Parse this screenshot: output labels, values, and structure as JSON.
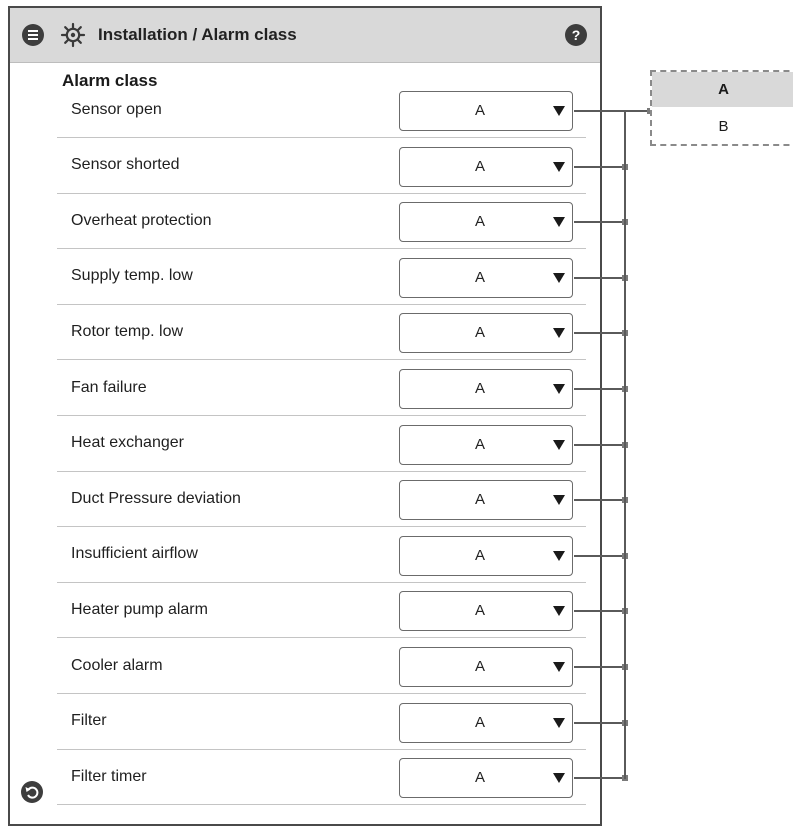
{
  "header": {
    "title": "Installation / Alarm class",
    "menu_icon": "menu-icon",
    "settings_icon": "gear-icon",
    "help_label": "?"
  },
  "section_title": "Alarm class",
  "rows": [
    {
      "label": "Sensor open",
      "value": "A"
    },
    {
      "label": "Sensor shorted",
      "value": "A"
    },
    {
      "label": "Overheat protection",
      "value": "A"
    },
    {
      "label": "Supply temp. low",
      "value": "A"
    },
    {
      "label": "Rotor temp. low",
      "value": "A"
    },
    {
      "label": "Fan failure",
      "value": "A"
    },
    {
      "label": "Heat exchanger",
      "value": "A"
    },
    {
      "label": "Duct Pressure deviation",
      "value": "A"
    },
    {
      "label": "Insufficient airflow",
      "value": "A"
    },
    {
      "label": "Heater pump alarm",
      "value": "A"
    },
    {
      "label": "Cooler alarm",
      "value": "A"
    },
    {
      "label": "Filter",
      "value": "A"
    },
    {
      "label": "Filter timer",
      "value": "A"
    }
  ],
  "dropdown": {
    "options": [
      "A",
      "B"
    ],
    "selected": "A"
  },
  "footer": {
    "back_icon": "back-icon"
  },
  "colors": {
    "header_bg": "#d9d9d9",
    "icon_dark": "#3d3d3d",
    "border": "#4a4a4a"
  }
}
